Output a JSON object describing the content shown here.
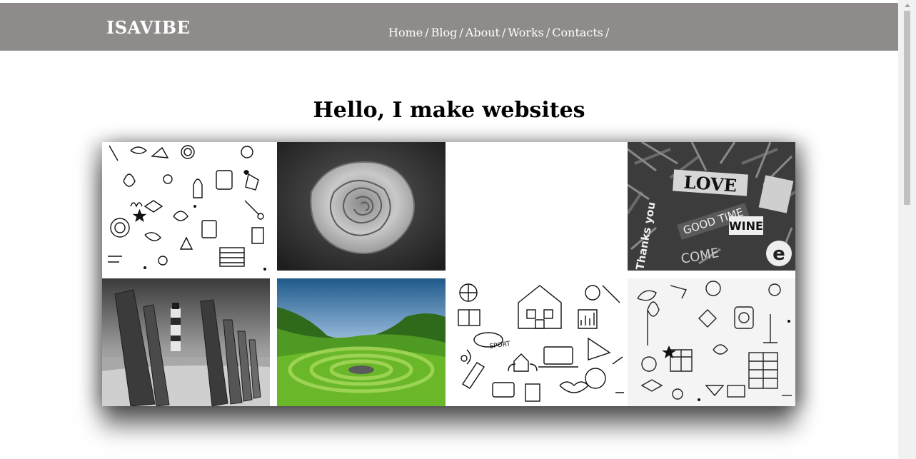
{
  "site": {
    "logo": "ISAVIBE"
  },
  "nav": {
    "items": [
      {
        "label": "Home"
      },
      {
        "label": "Blog"
      },
      {
        "label": "About"
      },
      {
        "label": "Works"
      },
      {
        "label": "Contacts"
      }
    ],
    "separator": "/"
  },
  "main": {
    "heading": "Hello, I make websites"
  },
  "gallery": {
    "tiles": [
      {
        "icon": "doodle-pattern-image"
      },
      {
        "icon": "rose-image"
      },
      {
        "icon": "blank-image"
      },
      {
        "icon": "collage-words-image",
        "words": [
          "LOVE",
          "GOOD TIME",
          "WINE",
          "Thanks you",
          "COME",
          "e"
        ]
      },
      {
        "icon": "lighthouse-image"
      },
      {
        "icon": "green-field-spiral-image"
      },
      {
        "icon": "school-doodles-image",
        "words": [
          "SPORT"
        ]
      },
      {
        "icon": "doodle-pattern-image"
      }
    ]
  },
  "colors": {
    "header_bg": "#8f8b8a",
    "header_text": "#ffffff",
    "page_bg": "#ffffff"
  }
}
